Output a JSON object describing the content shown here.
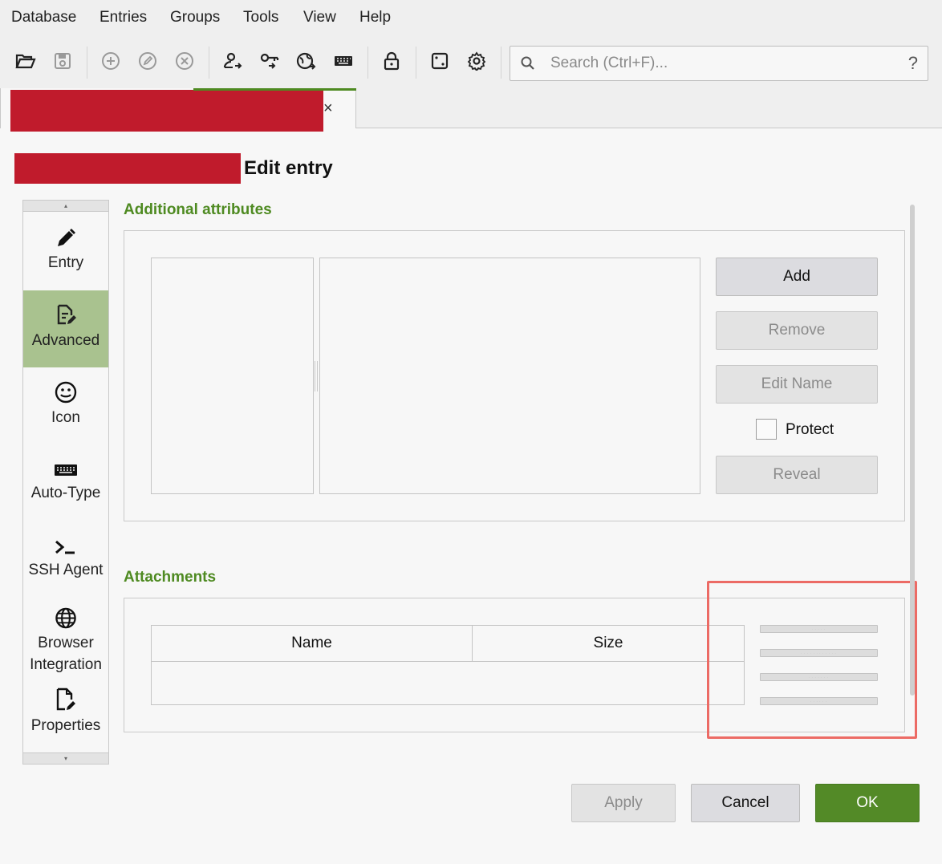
{
  "menu": [
    "Database",
    "Entries",
    "Groups",
    "Tools",
    "View",
    "Help"
  ],
  "toolbar": {
    "icons": [
      "open-database-icon",
      "save-database-icon",
      "add-entry-icon",
      "edit-entry-icon",
      "delete-entry-icon",
      "copy-username-icon",
      "copy-password-icon",
      "copy-url-icon",
      "perform-autotype-icon",
      "lock-database-icon",
      "password-generator-icon",
      "settings-icon"
    ],
    "search_placeholder": "Search (Ctrl+F)...",
    "search_help": "?"
  },
  "tab": {
    "close": "×"
  },
  "page": {
    "title": "Edit entry"
  },
  "sidebar": {
    "items": [
      {
        "label": "Entry",
        "icon": "pencil-icon"
      },
      {
        "label": "Advanced",
        "icon": "document-edit-icon",
        "active": true
      },
      {
        "label": "Icon",
        "icon": "smiley-icon"
      },
      {
        "label": "Auto-Type",
        "icon": "keyboard-icon"
      },
      {
        "label": "SSH Agent",
        "icon": "terminal-icon"
      },
      {
        "label": "Browser\nIntegration",
        "icon": "globe-icon"
      },
      {
        "label": "Properties",
        "icon": "file-edit-icon"
      }
    ]
  },
  "attributes": {
    "heading": "Additional attributes",
    "add": "Add",
    "remove": "Remove",
    "edit_name": "Edit Name",
    "protect": "Protect",
    "reveal": "Reveal"
  },
  "attachments": {
    "heading": "Attachments",
    "columns": [
      "Name",
      "Size"
    ]
  },
  "footer": {
    "apply": "Apply",
    "cancel": "Cancel",
    "ok": "OK"
  },
  "colors": {
    "accent_green": "#4e8a21",
    "active_category": "#a9c28f",
    "redaction": "#c01b2c",
    "highlight": "#ec6b65"
  }
}
